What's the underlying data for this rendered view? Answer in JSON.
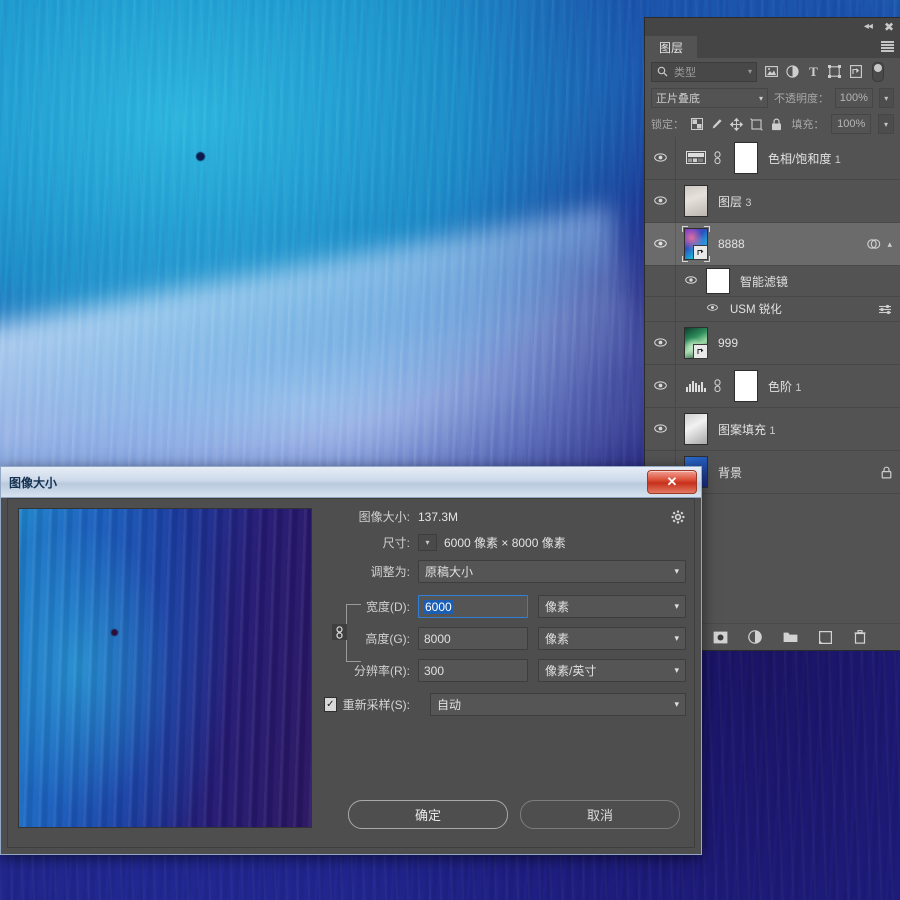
{
  "panel": {
    "topbar": {
      "collapse_icon": "double-chevron-left",
      "close_icon": "close-x"
    },
    "tab_label": "图层",
    "menu_icon": "hamburger-menu",
    "filter": {
      "search_icon": "search-icon",
      "kind_label": "类型",
      "icons": [
        "pixel-filter-icon",
        "adjustment-filter-icon",
        "type-filter-icon",
        "shape-filter-icon",
        "smart-object-filter-icon"
      ],
      "toggle": "filter-enable-toggle"
    },
    "blend": {
      "mode": "正片叠底",
      "opacity_label": "不透明度：",
      "opacity_value": "100%"
    },
    "lock": {
      "label": "锁定：",
      "icons": [
        "lock-transparent-pixels-icon",
        "lock-image-pixels-icon",
        "lock-position-icon",
        "lock-artboard-icon",
        "lock-all-icon"
      ],
      "fill_label": "填充：",
      "fill_value": "100%"
    },
    "layers": [
      {
        "name": "色相/饱和度",
        "suffix": "1",
        "type": "adjustment",
        "thumb": "hue-saturation-icon",
        "has_mask": true,
        "linked": true,
        "visible": true,
        "selected": false
      },
      {
        "name": "图层",
        "suffix": "3",
        "type": "pixel",
        "thumb": "texture",
        "visible": true,
        "selected": false
      },
      {
        "name": "8888",
        "suffix": "",
        "type": "smart-object",
        "thumb": "art-8888",
        "visible": true,
        "selected": true,
        "right_icons": [
          "smart-filter-icon",
          "collapse-chevron"
        ]
      },
      {
        "name": "智能滤镜",
        "suffix": "",
        "type": "smart-filter-group",
        "sub": true,
        "visible": true,
        "selected": false
      },
      {
        "name": "USM 锐化",
        "suffix": "",
        "type": "smart-filter",
        "sub": true,
        "sub2": true,
        "visible": true,
        "selected": false,
        "right_icons": [
          "filter-blending-options-icon"
        ]
      },
      {
        "name": "999",
        "suffix": "",
        "type": "smart-object",
        "thumb": "art-999",
        "visible": true,
        "selected": false
      },
      {
        "name": "色阶",
        "suffix": "1",
        "type": "adjustment",
        "thumb": "levels-icon",
        "has_mask": true,
        "linked": true,
        "visible": true,
        "selected": false
      },
      {
        "name": "图案填充",
        "suffix": "1",
        "type": "fill",
        "thumb": "pattern",
        "visible": true,
        "selected": false
      },
      {
        "name": "背景",
        "suffix": "",
        "type": "background",
        "visible": true,
        "selected": false,
        "locked": true
      }
    ],
    "bottom_icons": [
      "fx-icon",
      "add-mask-icon",
      "new-adjustment-layer-icon",
      "new-group-icon",
      "new-layer-icon",
      "delete-layer-icon"
    ]
  },
  "dialog": {
    "title": "图像大小",
    "close_label": "✕",
    "image_size_label": "图像大小:",
    "image_size_value": "137.3M",
    "gear_icon": "gear-icon",
    "dimensions_label": "尺寸:",
    "dimensions_value": "6000 像素 × 8000 像素",
    "fit_to_label": "调整为:",
    "fit_to_value": "原稿大小",
    "width_label": "宽度(D):",
    "width_value": "6000",
    "width_unit": "像素",
    "height_label": "高度(G):",
    "height_value": "8000",
    "height_unit": "像素",
    "resolution_label": "分辨率(R):",
    "resolution_value": "300",
    "resolution_unit": "像素/英寸",
    "resample_label": "重新采样(S):",
    "resample_value": "自动",
    "resample_checked": true,
    "link_icon": "chain-link-icon",
    "ok_label": "确定",
    "cancel_label": "取消"
  }
}
